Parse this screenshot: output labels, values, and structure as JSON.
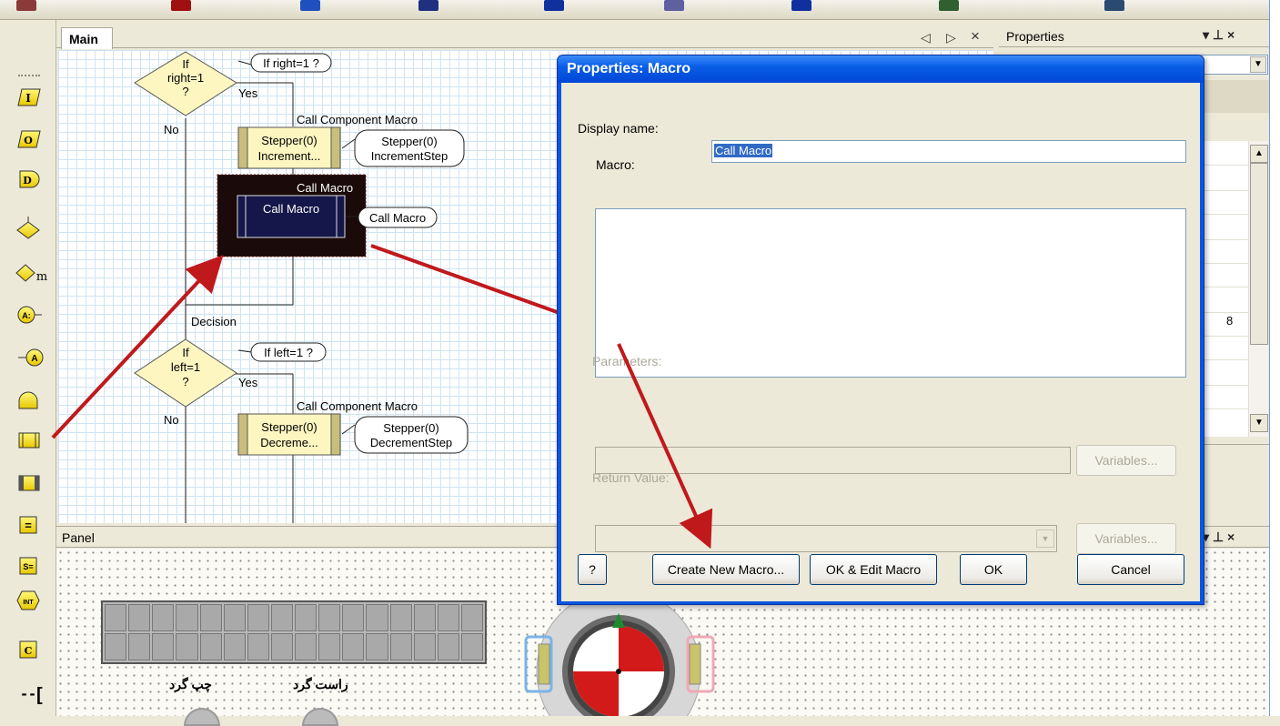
{
  "main_tab": {
    "label": "Main",
    "nav_left": "◁",
    "nav_right": "▷",
    "close": "×"
  },
  "properties_panel": {
    "title": "Properties",
    "pin": "▾ ⊥ ×",
    "value_fragment": "8"
  },
  "flowchart": {
    "decision1": {
      "line1": "If",
      "line2": "right=1",
      "line3": "?",
      "yes": "Yes",
      "no": "No",
      "comment": "If right=1 ?"
    },
    "component1": {
      "header": "Call Component Macro",
      "line1": "Stepper(0)",
      "line2": "Increment...",
      "comment_line1": "Stepper(0)",
      "comment_line2": "IncrementStep"
    },
    "macro_block": {
      "header": "Call Macro",
      "label": "Call Macro",
      "comment": "Call Macro"
    },
    "decision_label": "Decision",
    "decision2": {
      "line1": "If",
      "line2": "left=1",
      "line3": "?",
      "yes": "Yes",
      "no": "No",
      "comment": "If left=1 ?"
    },
    "component2": {
      "header": "Call Component Macro",
      "line1": "Stepper(0)",
      "line2": "Decreme...",
      "comment_line1": "Stepper(0)",
      "comment_line2": "DecrementStep"
    }
  },
  "panel": {
    "title": "Panel",
    "controls": "▾ ⊥ ×",
    "left_label": "چپ گرد",
    "right_label": "راست گرد"
  },
  "dialog": {
    "title": "Properties: Macro",
    "display_name_label": "Display name:",
    "display_name_value": "Call Macro",
    "macro_label": "Macro:",
    "parameters_label": "Parameters:",
    "return_value_label": "Return Value:",
    "variables_button_1": "Variables...",
    "variables_button_2": "Variables...",
    "help_button": "?",
    "create_button": "Create New Macro...",
    "ok_edit_button": "OK & Edit Macro",
    "ok_button": "OK",
    "cancel_button": "Cancel"
  },
  "palette": {
    "icons": [
      "input-icon",
      "output-icon",
      "delay-icon",
      "decision-icon",
      "switch-icon",
      "connection-point-icon",
      "goto-icon",
      "loop-icon",
      "macro-icon",
      "component-macro-icon",
      "calculation-icon",
      "string-icon",
      "interrupt-icon",
      "c-code-icon",
      "comment-icon"
    ],
    "letters": {
      "input": "I",
      "output": "O",
      "delay": "D",
      "switch": "m",
      "connection": "A:",
      "goto": "A",
      "calc": "=",
      "string": "S=",
      "interrupt": "INT",
      "ccode": "C",
      "comment": "["
    }
  },
  "colors": {
    "accent": "#0a56e0",
    "decision_fill": "#fdf6c0",
    "selection": "#1a1a4a",
    "arrow": "#c0191c"
  }
}
